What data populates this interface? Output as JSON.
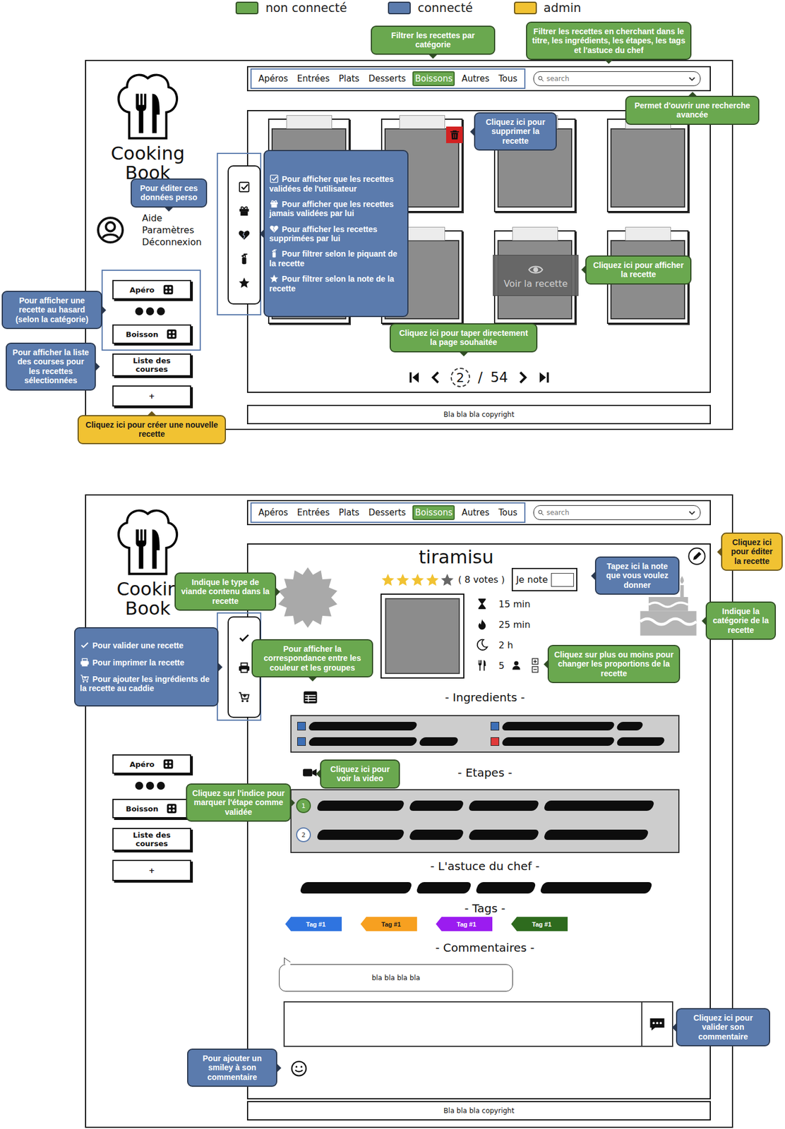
{
  "legend": [
    {
      "label": "non connecté",
      "color": "#6aa84f"
    },
    {
      "label": "connecté",
      "color": "#5b7bad"
    },
    {
      "label": "admin",
      "color": "#f1c232"
    }
  ],
  "list_page": {
    "logo": [
      "Cooking",
      "Book"
    ],
    "nav": {
      "categories": [
        {
          "label": "Apéros",
          "selected": false
        },
        {
          "label": "Entrées",
          "selected": false
        },
        {
          "label": "Plats",
          "selected": false
        },
        {
          "label": "Desserts",
          "selected": false
        },
        {
          "label": "Boissons",
          "selected": true
        },
        {
          "label": "Autres",
          "selected": false
        },
        {
          "label": "Tous",
          "selected": false
        }
      ],
      "search_placeholder": "search"
    },
    "user_menu": [
      "Aide",
      "Paramètres",
      "Déconnexion"
    ],
    "random": {
      "highlighted": true,
      "buttons": [
        "Apéro",
        "Boisson"
      ]
    },
    "shopping_list": "Liste des courses",
    "add_recipe": "+",
    "cards": [
      {
        "deletable": false,
        "hovered": false
      },
      {
        "deletable": true,
        "hovered": false
      },
      {
        "deletable": false,
        "hovered": false
      },
      {
        "deletable": false,
        "hovered": false
      },
      {
        "deletable": false,
        "hovered": false
      },
      {
        "deletable": false,
        "hovered": false
      },
      {
        "deletable": false,
        "hovered": true
      },
      {
        "deletable": false,
        "hovered": false
      }
    ],
    "view_label": "Voir la recette",
    "pagination": {
      "current": "2",
      "separator": "/",
      "total": "54"
    },
    "footer": "Bla bla bla copyright",
    "callouts": [
      {
        "kind": "note",
        "color": "#6aa84f",
        "text": "Filtrer les recettes par catégorie"
      },
      {
        "kind": "note",
        "color": "#6aa84f",
        "text": "Filtrer les recettes en cherchant dans le titre, les ingrédients, les étapes, les tags et l'astuce du chef"
      },
      {
        "kind": "note",
        "color": "#6aa84f",
        "text": "Permet d'ouvrir une recherche avancée"
      },
      {
        "kind": "note",
        "color": "#5b7bad",
        "text": "Cliquez ici pour supprimer la recette"
      },
      {
        "kind": "note",
        "color": "#5b7bad",
        "text": "Pour éditer ces données perso"
      },
      {
        "kind": "list",
        "color": "#5b7bad",
        "items": [
          "Pour afficher que les recettes validées de l'utilisateur",
          "Pour afficher que les recettes jamais validées par lui",
          "Pour afficher les recettes supprimées par lui",
          "Pour filtrer selon le piquant de la recette",
          "Pour filtrer selon la note de la recette"
        ]
      },
      {
        "kind": "note",
        "color": "#6aa84f",
        "text": "Cliquez ici pour afficher la recette"
      },
      {
        "kind": "note",
        "color": "#6aa84f",
        "text": "Cliquez ici pour taper directement la page souhaitée"
      },
      {
        "kind": "note",
        "color": "#5b7bad",
        "text": "Pour afficher une recette au hasard (selon la catégorie)"
      },
      {
        "kind": "note",
        "color": "#5b7bad",
        "text": "Pour afficher la liste des courses pour les recettes sélectionnées"
      },
      {
        "kind": "note",
        "color": "#f1c232",
        "text": "Cliquez ici pour créer une nouvelle recette"
      }
    ]
  },
  "recipe_page": {
    "logo": [
      "Cookin",
      "Book"
    ],
    "nav": {
      "categories": [
        {
          "label": "Apéros",
          "selected": false
        },
        {
          "label": "Entrées",
          "selected": false
        },
        {
          "label": "Plats",
          "selected": false
        },
        {
          "label": "Desserts",
          "selected": false
        },
        {
          "label": "Boissons",
          "selected": true
        },
        {
          "label": "Autres",
          "selected": false
        },
        {
          "label": "Tous",
          "selected": false
        }
      ],
      "search_placeholder": "search"
    },
    "random": {
      "highlighted": false,
      "buttons": [
        "Apéro",
        "Boisson"
      ]
    },
    "shopping_list": "Liste des courses",
    "add_recipe": "+",
    "recipe": {
      "title": "tiramisu",
      "stars": 4,
      "out_of": 5,
      "votes": "( 8 votes )",
      "rate_label": "Je note",
      "rate_value": "",
      "times": [
        {
          "kind": "prep",
          "value": "15 min"
        },
        {
          "kind": "cook",
          "value": "25 min"
        },
        {
          "kind": "rest",
          "value": "2 h"
        }
      ],
      "servings": "5",
      "ingredients_title": "- Ingredients -",
      "ingredients": [
        {
          "color": "#3d6fb6"
        },
        {
          "color": "#3d6fb6"
        },
        {
          "color": "#3d6fb6"
        },
        {
          "color": "#e03a3a"
        }
      ],
      "steps_title": "- Etapes -",
      "steps": [
        {
          "number": "1",
          "validated": true
        },
        {
          "number": "2",
          "validated": false
        }
      ],
      "tip_title": "- L'astuce du chef -",
      "tags_title": "- Tags -",
      "tags": [
        {
          "label": "Tag #1",
          "color": "#2f74e0"
        },
        {
          "label": "Tag #1",
          "color": "#f7a020"
        },
        {
          "label": "Tag #1",
          "color": "#9b1cf0"
        },
        {
          "label": "Tag #1",
          "color": "#2e6b1e"
        }
      ],
      "comments_title": "- Commentaires -",
      "comments": [
        "bla bla bla bla"
      ],
      "comment_draft": ""
    },
    "footer": "Bla bla bla copyright",
    "callouts": [
      {
        "kind": "note",
        "color": "#f1c232",
        "text": "Cliquez ici pour éditer la recette"
      },
      {
        "kind": "note",
        "color": "#5b7bad",
        "text": "Tapez ici la note que vous voulez donner"
      },
      {
        "kind": "note",
        "color": "#6aa84f",
        "text": "Indique le type de viande contenu dans la recette"
      },
      {
        "kind": "note",
        "color": "#6aa84f",
        "text": "Indique la catégorie de la recette"
      },
      {
        "kind": "list",
        "color": "#5b7bad",
        "items": [
          "Pour valider une recette",
          "Pour imprimer la recette",
          "Pour ajouter les ingrédients de la recette au caddie"
        ]
      },
      {
        "kind": "note",
        "color": "#6aa84f",
        "text": "Pour afficher la correspondance entre les couleur et les groupes"
      },
      {
        "kind": "note",
        "color": "#6aa84f",
        "text": "Cliquez sur plus ou moins pour changer les proportions de la recette"
      },
      {
        "kind": "note",
        "color": "#6aa84f",
        "text": "Cliquez ici pour voir la video"
      },
      {
        "kind": "note",
        "color": "#6aa84f",
        "text": "Cliquez sur l'indice pour marquer l'étape comme validée"
      },
      {
        "kind": "note",
        "color": "#5b7bad",
        "text": "Cliquez ici pour valider son commentaire"
      },
      {
        "kind": "note",
        "color": "#5b7bad",
        "text": "Pour ajouter un smiley à son commentaire"
      }
    ]
  }
}
